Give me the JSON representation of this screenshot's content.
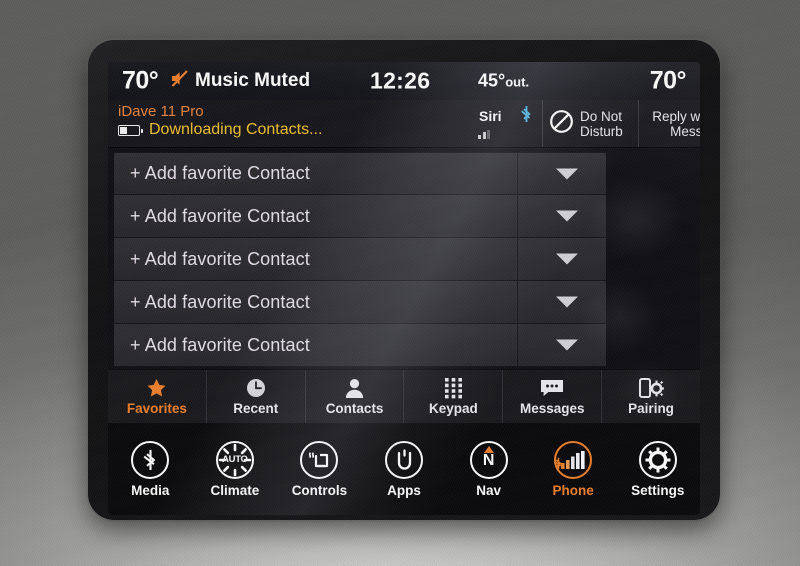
{
  "status_bar": {
    "temp_left": "70°",
    "muted_label": "Music Muted",
    "muted_icon": "speaker-muted-icon",
    "clock": "12:26",
    "outside_degrees": "45°",
    "outside_label": "out.",
    "temp_right": "70°"
  },
  "phone_bar": {
    "device_name": "iDave 11 Pro",
    "device_status": "Downloading Contacts...",
    "battery_icon": "battery-low-icon",
    "siri_label": "Siri",
    "bluetooth_icon": "bluetooth-icon",
    "signal_icon": "signal-bars-icon",
    "do_not_disturb": {
      "line1": "Do Not",
      "line2": "Disturb",
      "icon": "no-entry-icon"
    },
    "reply_with_text": {
      "line1": "Reply with Text",
      "line2": "Message"
    }
  },
  "favorites": {
    "rows": [
      {
        "label": "+ Add favorite Contact"
      },
      {
        "label": "+ Add favorite Contact"
      },
      {
        "label": "+ Add favorite Contact"
      },
      {
        "label": "+ Add favorite Contact"
      },
      {
        "label": "+ Add favorite Contact"
      }
    ]
  },
  "tabs": [
    {
      "label": "Favorites",
      "icon": "star-icon",
      "active": true
    },
    {
      "label": "Recent",
      "icon": "clock-icon",
      "active": false
    },
    {
      "label": "Contacts",
      "icon": "person-icon",
      "active": false
    },
    {
      "label": "Keypad",
      "icon": "keypad-icon",
      "active": false
    },
    {
      "label": "Messages",
      "icon": "message-bubble-icon",
      "active": false
    },
    {
      "label": "Pairing",
      "icon": "phone-gear-icon",
      "active": false
    }
  ],
  "nav": [
    {
      "label": "Media",
      "icon": "bluetooth-icon",
      "active": false
    },
    {
      "label": "Climate",
      "icon": "auto-fan-icon",
      "active": false
    },
    {
      "label": "Controls",
      "icon": "heated-seat-icon",
      "active": false
    },
    {
      "label": "Apps",
      "icon": "uconnect-logo-icon",
      "active": false
    },
    {
      "label": "Nav",
      "icon": "compass-north-icon",
      "active": false
    },
    {
      "label": "Phone",
      "icon": "signal-bars-icon",
      "active": true
    },
    {
      "label": "Settings",
      "icon": "gear-icon",
      "active": false
    }
  ],
  "colors": {
    "accent_orange": "#ef7f28",
    "status_yellow": "#f2c02c",
    "bluetooth_blue": "#4bb6e8",
    "screen_black": "#0a0a0e"
  }
}
